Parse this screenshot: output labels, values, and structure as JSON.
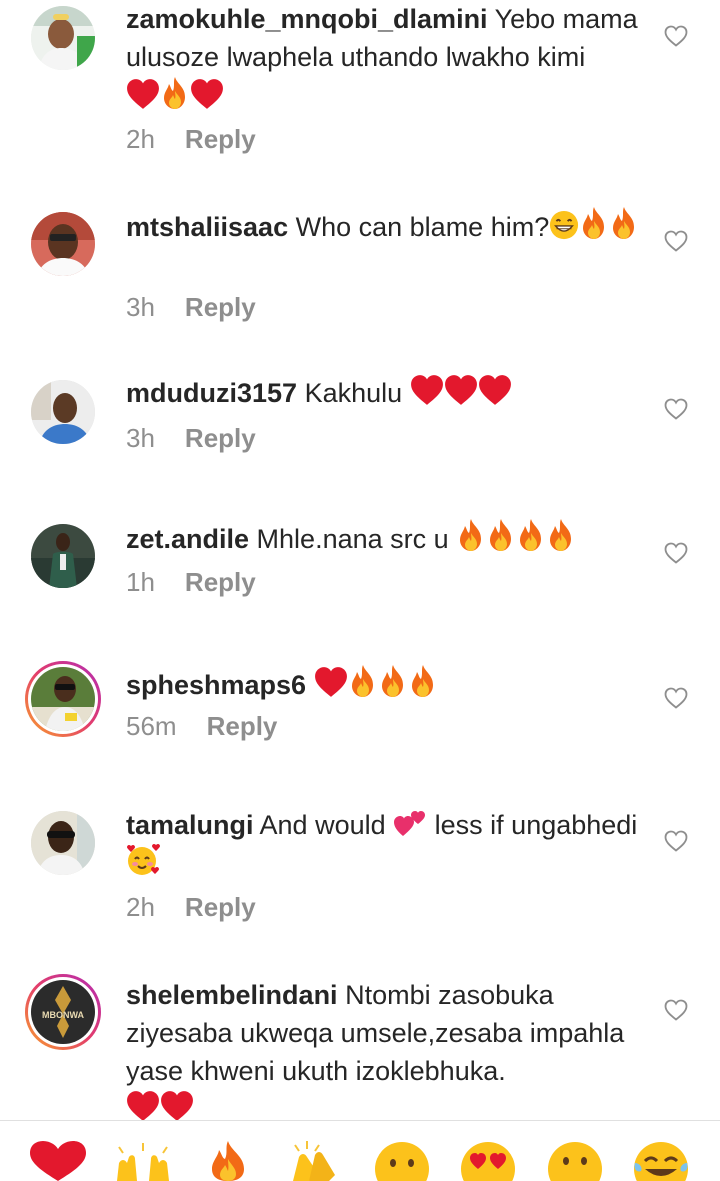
{
  "comments": [
    {
      "username": "zamokuhle_mnqobi_dlamini",
      "text": "Yebo mama ulusoze lwaphela uthando lwakho kimi",
      "time": "2h",
      "reply": "Reply"
    },
    {
      "username": "mtshaliisaac",
      "text": "Who can blame him?",
      "time": "3h",
      "reply": "Reply"
    },
    {
      "username": "mduduzi3157",
      "text": "Kakhulu",
      "time": "3h",
      "reply": "Reply"
    },
    {
      "username": "zet.andile",
      "text": "Mhle.nana src u",
      "time": "1h",
      "reply": "Reply"
    },
    {
      "username": "spheshmaps6",
      "text": "",
      "time": "56m",
      "reply": "Reply"
    },
    {
      "username": "tamalungi",
      "text": "And would",
      "text2": "less if ungabhedi",
      "time": "2h",
      "reply": "Reply"
    },
    {
      "username": "shelembelindani",
      "text": "Ntombi zasobuka ziyesaba ukweqa umsele,zesaba impahla yase khweni ukuth izoklebhuka.",
      "time": "",
      "reply": ""
    }
  ],
  "avatar_texts": {
    "shelembe_logo": "MBONWA"
  },
  "quick_emojis": [
    "red-heart",
    "raising-hands",
    "fire",
    "clapping-hands",
    "crying-face",
    "heart-eyes",
    "surprised-face",
    "tears-of-joy"
  ],
  "colors": {
    "text": "#262626",
    "meta": "#8e8e8e",
    "heart": "#e3182d",
    "ring_start": "#f9a22c",
    "ring_end": "#b22bb5"
  }
}
